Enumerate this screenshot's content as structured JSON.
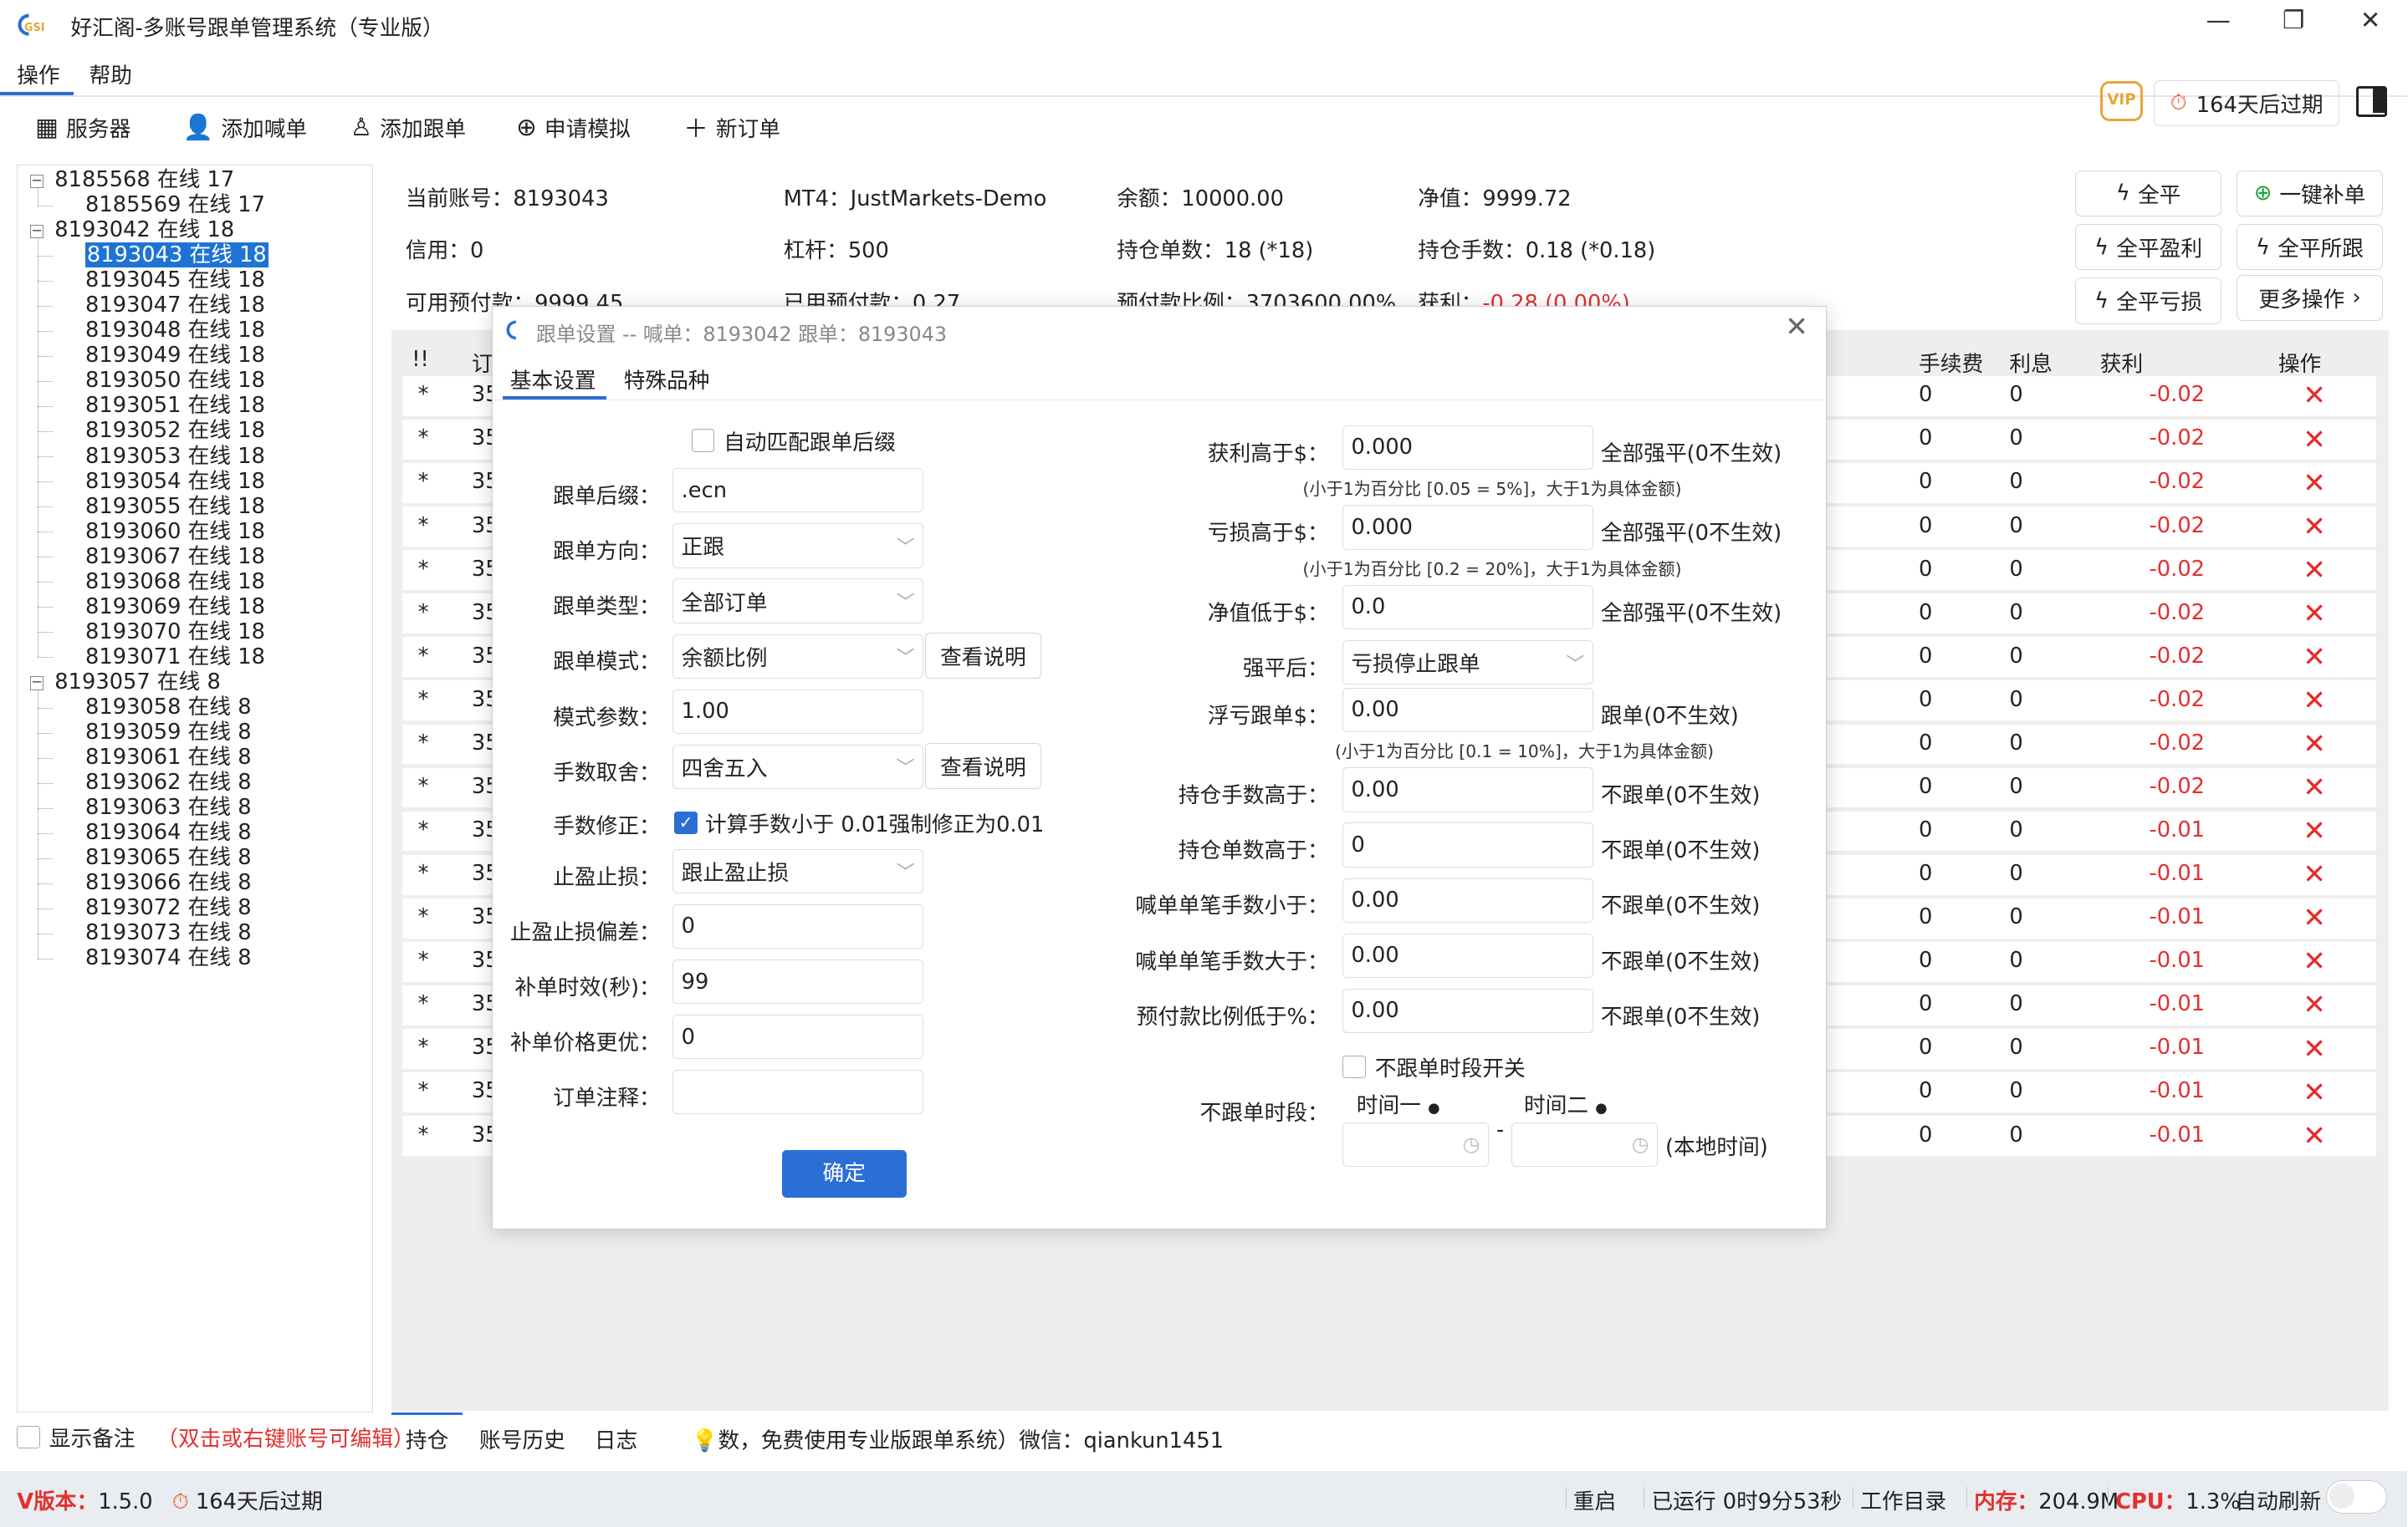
{
  "window": {
    "title": "好汇阁-多账号跟单管理系统（专业版）",
    "logo_text": "GSI"
  },
  "menu": [
    "操作",
    "帮助"
  ],
  "toolbar": {
    "server": "服务器",
    "add_caller": "添加喊单",
    "add_follower": "添加跟单",
    "apply_demo": "申请模拟",
    "new_order": "新订单",
    "vip": "VIP",
    "expire": "164天后过期"
  },
  "tree": [
    {
      "label": "8185568 在线 17",
      "level": 0
    },
    {
      "label": "8185569 在线 17",
      "level": 1
    },
    {
      "label": "8193042 在线 18",
      "level": 0
    },
    {
      "label": "8193043 在线 18",
      "level": 1,
      "selected": true
    },
    {
      "label": "8193045 在线 18",
      "level": 1
    },
    {
      "label": "8193047 在线 18",
      "level": 1
    },
    {
      "label": "8193048 在线 18",
      "level": 1
    },
    {
      "label": "8193049 在线 18",
      "level": 1
    },
    {
      "label": "8193050 在线 18",
      "level": 1
    },
    {
      "label": "8193051 在线 18",
      "level": 1
    },
    {
      "label": "8193052 在线 18",
      "level": 1
    },
    {
      "label": "8193053 在线 18",
      "level": 1
    },
    {
      "label": "8193054 在线 18",
      "level": 1
    },
    {
      "label": "8193055 在线 18",
      "level": 1
    },
    {
      "label": "8193060 在线 18",
      "level": 1
    },
    {
      "label": "8193067 在线 18",
      "level": 1
    },
    {
      "label": "8193068 在线 18",
      "level": 1
    },
    {
      "label": "8193069 在线 18",
      "level": 1
    },
    {
      "label": "8193070 在线 18",
      "level": 1
    },
    {
      "label": "8193071 在线 18",
      "level": 1
    },
    {
      "label": "8193057 在线 8",
      "level": 0
    },
    {
      "label": "8193058 在线 8",
      "level": 1
    },
    {
      "label": "8193059 在线 8",
      "level": 1
    },
    {
      "label": "8193061 在线 8",
      "level": 1
    },
    {
      "label": "8193062 在线 8",
      "level": 1
    },
    {
      "label": "8193063 在线 8",
      "level": 1
    },
    {
      "label": "8193064 在线 8",
      "level": 1
    },
    {
      "label": "8193065 在线 8",
      "level": 1
    },
    {
      "label": "8193066 在线 8",
      "level": 1
    },
    {
      "label": "8193072 在线 8",
      "level": 1
    },
    {
      "label": "8193073 在线 8",
      "level": 1
    },
    {
      "label": "8193074 在线 8",
      "level": 1
    }
  ],
  "show_memo": {
    "label": "显示备注",
    "hint": "（双击或右键账号可编辑）"
  },
  "account": {
    "current": "当前账号：8193043",
    "mt4": "MT4：JustMarkets-Demo",
    "balance": "余额：10000.00",
    "equity": "净值：9999.72",
    "credit": "信用：0",
    "leverage": "杠杆：500",
    "positions": "持仓单数：18 (*18)",
    "lots": "持仓手数：0.18 (*0.18)",
    "free_margin": "可用预付款：9999.45",
    "used_margin": "已用预付款：0.27",
    "margin_ratio": "预付款比例：3703600.00%",
    "profit_label": "获利：",
    "profit_value": "-0.28 (0.00%)"
  },
  "actions": {
    "close_all": "全平",
    "one_key_fill": "一键补单",
    "close_profit": "全平盈利",
    "close_all_accounts": "全平所跟",
    "close_loss": "全平亏损",
    "more": "更多操作"
  },
  "table": {
    "headers": {
      "flag": "!!",
      "order": "订",
      "fee": "手续费",
      "interest": "利息",
      "profit": "获利",
      "ops": "操作"
    },
    "rows": [
      {
        "star": "*",
        "order": "35",
        "fee": "0",
        "interest": "0",
        "profit": "-0.02"
      },
      {
        "star": "*",
        "order": "35",
        "fee": "0",
        "interest": "0",
        "profit": "-0.02"
      },
      {
        "star": "*",
        "order": "35",
        "fee": "0",
        "interest": "0",
        "profit": "-0.02"
      },
      {
        "star": "*",
        "order": "35",
        "fee": "0",
        "interest": "0",
        "profit": "-0.02"
      },
      {
        "star": "*",
        "order": "35",
        "fee": "0",
        "interest": "0",
        "profit": "-0.02"
      },
      {
        "star": "*",
        "order": "35",
        "fee": "0",
        "interest": "0",
        "profit": "-0.02"
      },
      {
        "star": "*",
        "order": "35",
        "fee": "0",
        "interest": "0",
        "profit": "-0.02"
      },
      {
        "star": "*",
        "order": "35",
        "fee": "0",
        "interest": "0",
        "profit": "-0.02"
      },
      {
        "star": "*",
        "order": "35",
        "fee": "0",
        "interest": "0",
        "profit": "-0.02"
      },
      {
        "star": "*",
        "order": "35",
        "fee": "0",
        "interest": "0",
        "profit": "-0.02"
      },
      {
        "star": "*",
        "order": "35",
        "fee": "0",
        "interest": "0",
        "profit": "-0.01"
      },
      {
        "star": "*",
        "order": "35",
        "fee": "0",
        "interest": "0",
        "profit": "-0.01"
      },
      {
        "star": "*",
        "order": "35",
        "fee": "0",
        "interest": "0",
        "profit": "-0.01"
      },
      {
        "star": "*",
        "order": "35",
        "fee": "0",
        "interest": "0",
        "profit": "-0.01"
      },
      {
        "star": "*",
        "order": "35",
        "fee": "0",
        "interest": "0",
        "profit": "-0.01"
      },
      {
        "star": "*",
        "order": "35",
        "fee": "0",
        "interest": "0",
        "profit": "-0.01"
      },
      {
        "star": "*",
        "order": "35",
        "fee": "0",
        "interest": "0",
        "profit": "-0.01"
      },
      {
        "star": "*",
        "order": "35",
        "fee": "0",
        "interest": "0",
        "profit": "-0.01"
      }
    ]
  },
  "bottom_tabs": [
    "持仓",
    "账号历史",
    "日志"
  ],
  "notice": "数，免费使用专业版跟单系统）微信：qiankun1451",
  "status": {
    "version_label": "V版本：",
    "version": "1.5.0",
    "expire": "164天后过期",
    "restart": "重启",
    "uptime": "已运行 0时9分53秒",
    "workdir": "工作目录",
    "mem_label": "内存：",
    "mem": "204.9M",
    "cpu_label": "CPU：",
    "cpu": "1.3%",
    "auto_refresh": "自动刷新"
  },
  "dialog": {
    "title": "跟单设置 -- 喊单：8193042 跟单：8193043",
    "tabs": [
      "基本设置",
      "特殊品种"
    ],
    "left": {
      "auto_match": "自动匹配跟单后缀",
      "suffix_label": "跟单后缀：",
      "suffix": ".ecn",
      "direction_label": "跟单方向：",
      "direction": "正跟",
      "type_label": "跟单类型：",
      "type": "全部订单",
      "mode_label": "跟单模式：",
      "mode": "余额比例",
      "help": "查看说明",
      "param_label": "模式参数：",
      "param": "1.00",
      "rounding_label": "手数取舍：",
      "rounding": "四舍五入",
      "lot_fix_label": "手数修正：",
      "lot_fix": "计算手数小于 0.01强制修正为0.01",
      "tpsl_label": "止盈止损：",
      "tpsl": "跟止盈止损",
      "tpsl_offset_label": "止盈止损偏差：",
      "tpsl_offset": "0",
      "fill_timeout_label": "补单时效(秒)：",
      "fill_timeout": "99",
      "fill_better_label": "补单价格更优：",
      "fill_better": "0",
      "comment_label": "订单注释：",
      "comment": ""
    },
    "right": {
      "profit_above_label": "获利高于$：",
      "profit_above": "0.000",
      "close_all_note": "全部强平(0不生效)",
      "profit_hint": "(小于1为百分比 [0.05 = 5%]，大于1为具体金额)",
      "loss_above_label": "亏损高于$：",
      "loss_above": "0.000",
      "loss_hint": "(小于1为百分比 [0.2 = 20%]，大于1为具体金额)",
      "equity_below_label": "净值低于$：",
      "equity_below": "0.0",
      "after_close_label": "强平后：",
      "after_close": "亏损停止跟单",
      "float_loss_label": "浮亏跟单$：",
      "float_loss": "0.00",
      "follow_note": "跟单(0不生效)",
      "float_hint": "(小于1为百分比 [0.1 = 10%]，大于1为具体金额)",
      "pos_lots_label": "持仓手数高于：",
      "pos_lots": "0.00",
      "no_follow_note": "不跟单(0不生效)",
      "pos_count_label": "持仓单数高于：",
      "pos_count": "0",
      "single_min_label": "喊单单笔手数小于：",
      "single_min": "0.00",
      "single_max_label": "喊单单笔手数大于：",
      "single_max": "0.00",
      "margin_ratio_label": "预付款比例低于%：",
      "margin_ratio": "0.00",
      "period_switch": "不跟单时段开关",
      "period_label": "不跟单时段：",
      "time1": "时间一",
      "time2": "时间二",
      "dash": "-",
      "local_time": "(本地时间)"
    },
    "ok": "确定"
  }
}
